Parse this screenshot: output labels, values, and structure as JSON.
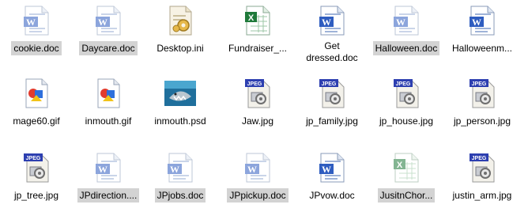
{
  "colors": {
    "selection": "#d3d3d3",
    "word_blue": "#2f5dc0",
    "excel_green": "#1f7a3a",
    "jpeg_blue": "#2d3fb0"
  },
  "files": [
    {
      "name": "cookie.doc",
      "icon": "word-doc-icon",
      "selected": true,
      "dim": true
    },
    {
      "name": "Daycare.doc",
      "icon": "word-doc-icon",
      "selected": true,
      "dim": true
    },
    {
      "name": "Desktop.ini",
      "icon": "settings-file-icon",
      "selected": false,
      "dim": false
    },
    {
      "name": "Fundraiser_...",
      "icon": "excel-icon",
      "selected": false,
      "dim": false
    },
    {
      "name": "Get dressed.doc",
      "icon": "word-doc-icon",
      "selected": false,
      "dim": false
    },
    {
      "name": "Halloween.doc",
      "icon": "word-doc-icon",
      "selected": true,
      "dim": true
    },
    {
      "name": "Halloweenm...",
      "icon": "word-doc-icon",
      "selected": false,
      "dim": false
    },
    {
      "name": "mage60.gif",
      "icon": "gif-image-icon",
      "selected": false,
      "dim": false
    },
    {
      "name": "inmouth.gif",
      "icon": "gif-image-icon",
      "selected": false,
      "dim": false
    },
    {
      "name": "inmouth.psd",
      "icon": "shark-photo-thumbnail-icon",
      "selected": false,
      "dim": false
    },
    {
      "name": "Jaw.jpg",
      "icon": "jpeg-icon",
      "selected": false,
      "dim": false
    },
    {
      "name": "jp_family.jpg",
      "icon": "jpeg-icon",
      "selected": false,
      "dim": false
    },
    {
      "name": "jp_house.jpg",
      "icon": "jpeg-icon",
      "selected": false,
      "dim": false
    },
    {
      "name": "jp_person.jpg",
      "icon": "jpeg-icon",
      "selected": false,
      "dim": false
    },
    {
      "name": "jp_tree.jpg",
      "icon": "jpeg-icon",
      "selected": false,
      "dim": false
    },
    {
      "name": "JPdirection....",
      "icon": "word-doc-icon",
      "selected": true,
      "dim": true
    },
    {
      "name": "JPjobs.doc",
      "icon": "word-doc-icon",
      "selected": true,
      "dim": true
    },
    {
      "name": "JPpickup.doc",
      "icon": "word-doc-icon",
      "selected": true,
      "dim": true
    },
    {
      "name": "JPvow.doc",
      "icon": "word-doc-icon",
      "selected": false,
      "dim": false
    },
    {
      "name": "JusitnChor...",
      "icon": "excel-icon",
      "selected": true,
      "dim": true
    },
    {
      "name": "justin_arm.jpg",
      "icon": "jpeg-icon",
      "selected": false,
      "dim": false
    }
  ]
}
